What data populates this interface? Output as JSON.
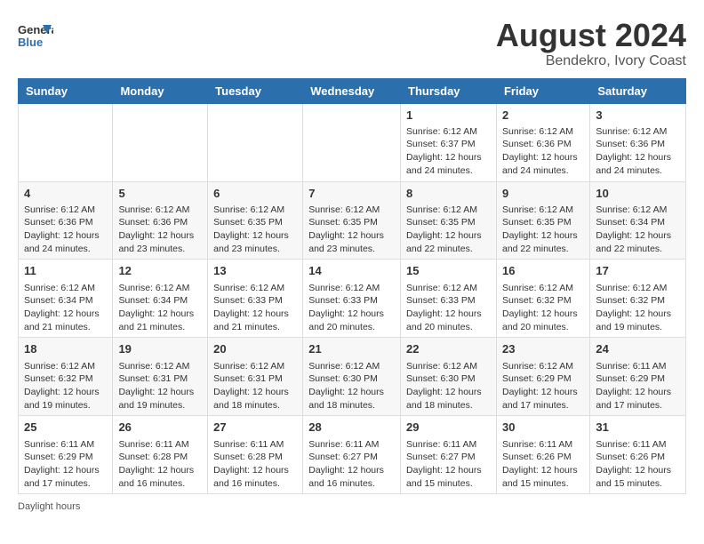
{
  "header": {
    "logo": {
      "general": "General",
      "blue": "Blue"
    },
    "month_year": "August 2024",
    "location": "Bendekro, Ivory Coast"
  },
  "days_of_week": [
    "Sunday",
    "Monday",
    "Tuesday",
    "Wednesday",
    "Thursday",
    "Friday",
    "Saturday"
  ],
  "weeks": [
    [
      {
        "day": "",
        "info": ""
      },
      {
        "day": "",
        "info": ""
      },
      {
        "day": "",
        "info": ""
      },
      {
        "day": "",
        "info": ""
      },
      {
        "day": "1",
        "info": "Sunrise: 6:12 AM\nSunset: 6:37 PM\nDaylight: 12 hours and 24 minutes."
      },
      {
        "day": "2",
        "info": "Sunrise: 6:12 AM\nSunset: 6:36 PM\nDaylight: 12 hours and 24 minutes."
      },
      {
        "day": "3",
        "info": "Sunrise: 6:12 AM\nSunset: 6:36 PM\nDaylight: 12 hours and 24 minutes."
      }
    ],
    [
      {
        "day": "4",
        "info": "Sunrise: 6:12 AM\nSunset: 6:36 PM\nDaylight: 12 hours and 24 minutes."
      },
      {
        "day": "5",
        "info": "Sunrise: 6:12 AM\nSunset: 6:36 PM\nDaylight: 12 hours and 23 minutes."
      },
      {
        "day": "6",
        "info": "Sunrise: 6:12 AM\nSunset: 6:35 PM\nDaylight: 12 hours and 23 minutes."
      },
      {
        "day": "7",
        "info": "Sunrise: 6:12 AM\nSunset: 6:35 PM\nDaylight: 12 hours and 23 minutes."
      },
      {
        "day": "8",
        "info": "Sunrise: 6:12 AM\nSunset: 6:35 PM\nDaylight: 12 hours and 22 minutes."
      },
      {
        "day": "9",
        "info": "Sunrise: 6:12 AM\nSunset: 6:35 PM\nDaylight: 12 hours and 22 minutes."
      },
      {
        "day": "10",
        "info": "Sunrise: 6:12 AM\nSunset: 6:34 PM\nDaylight: 12 hours and 22 minutes."
      }
    ],
    [
      {
        "day": "11",
        "info": "Sunrise: 6:12 AM\nSunset: 6:34 PM\nDaylight: 12 hours and 21 minutes."
      },
      {
        "day": "12",
        "info": "Sunrise: 6:12 AM\nSunset: 6:34 PM\nDaylight: 12 hours and 21 minutes."
      },
      {
        "day": "13",
        "info": "Sunrise: 6:12 AM\nSunset: 6:33 PM\nDaylight: 12 hours and 21 minutes."
      },
      {
        "day": "14",
        "info": "Sunrise: 6:12 AM\nSunset: 6:33 PM\nDaylight: 12 hours and 20 minutes."
      },
      {
        "day": "15",
        "info": "Sunrise: 6:12 AM\nSunset: 6:33 PM\nDaylight: 12 hours and 20 minutes."
      },
      {
        "day": "16",
        "info": "Sunrise: 6:12 AM\nSunset: 6:32 PM\nDaylight: 12 hours and 20 minutes."
      },
      {
        "day": "17",
        "info": "Sunrise: 6:12 AM\nSunset: 6:32 PM\nDaylight: 12 hours and 19 minutes."
      }
    ],
    [
      {
        "day": "18",
        "info": "Sunrise: 6:12 AM\nSunset: 6:32 PM\nDaylight: 12 hours and 19 minutes."
      },
      {
        "day": "19",
        "info": "Sunrise: 6:12 AM\nSunset: 6:31 PM\nDaylight: 12 hours and 19 minutes."
      },
      {
        "day": "20",
        "info": "Sunrise: 6:12 AM\nSunset: 6:31 PM\nDaylight: 12 hours and 18 minutes."
      },
      {
        "day": "21",
        "info": "Sunrise: 6:12 AM\nSunset: 6:30 PM\nDaylight: 12 hours and 18 minutes."
      },
      {
        "day": "22",
        "info": "Sunrise: 6:12 AM\nSunset: 6:30 PM\nDaylight: 12 hours and 18 minutes."
      },
      {
        "day": "23",
        "info": "Sunrise: 6:12 AM\nSunset: 6:29 PM\nDaylight: 12 hours and 17 minutes."
      },
      {
        "day": "24",
        "info": "Sunrise: 6:11 AM\nSunset: 6:29 PM\nDaylight: 12 hours and 17 minutes."
      }
    ],
    [
      {
        "day": "25",
        "info": "Sunrise: 6:11 AM\nSunset: 6:29 PM\nDaylight: 12 hours and 17 minutes."
      },
      {
        "day": "26",
        "info": "Sunrise: 6:11 AM\nSunset: 6:28 PM\nDaylight: 12 hours and 16 minutes."
      },
      {
        "day": "27",
        "info": "Sunrise: 6:11 AM\nSunset: 6:28 PM\nDaylight: 12 hours and 16 minutes."
      },
      {
        "day": "28",
        "info": "Sunrise: 6:11 AM\nSunset: 6:27 PM\nDaylight: 12 hours and 16 minutes."
      },
      {
        "day": "29",
        "info": "Sunrise: 6:11 AM\nSunset: 6:27 PM\nDaylight: 12 hours and 15 minutes."
      },
      {
        "day": "30",
        "info": "Sunrise: 6:11 AM\nSunset: 6:26 PM\nDaylight: 12 hours and 15 minutes."
      },
      {
        "day": "31",
        "info": "Sunrise: 6:11 AM\nSunset: 6:26 PM\nDaylight: 12 hours and 15 minutes."
      }
    ]
  ],
  "footer": {
    "daylight_label": "Daylight hours"
  }
}
